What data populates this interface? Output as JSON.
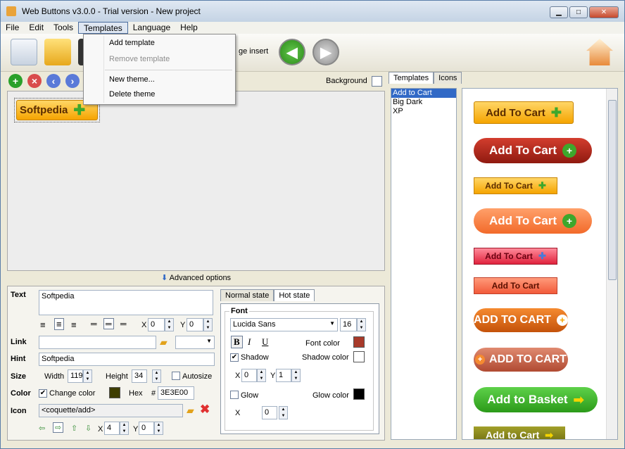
{
  "window": {
    "title": "Web Buttons v3.0.0 - Trial version - New project",
    "min": "▁",
    "max": "□",
    "close": "✕"
  },
  "menu": [
    "File",
    "Edit",
    "Tools",
    "Templates",
    "Language",
    "Help"
  ],
  "templates_menu": {
    "add": "Add template",
    "remove": "Remove template",
    "new_theme": "New theme...",
    "delete_theme": "Delete theme"
  },
  "toolbar": {
    "insert_label": "ge insert"
  },
  "canvas": {
    "button_label": "Softpedia",
    "background_label": "Background"
  },
  "advanced": "Advanced options",
  "props": {
    "text_label": "Text",
    "text_value": "Softpedia",
    "x_label": "X",
    "x_value": "0",
    "y_label": "Y",
    "y_value": "0",
    "link_label": "Link",
    "hint_label": "Hint",
    "hint_value": "Softpedia",
    "size_label": "Size",
    "width_label": "Width",
    "width_value": "119",
    "height_label": "Height",
    "height_value": "34",
    "autosize": "Autosize",
    "color_label": "Color",
    "change_color": "Change color",
    "hex_label": "Hex",
    "hash": "#",
    "hex_value": "3E3E00",
    "icon_label": "Icon",
    "icon_value": "<coquette/add>",
    "icon_x": "4",
    "icon_y": "0"
  },
  "state_tabs": [
    "Normal state",
    "Hot state"
  ],
  "font": {
    "group": "Font",
    "family": "Lucida Sans",
    "size": "16",
    "font_color": "Font color",
    "shadow": "Shadow",
    "shadow_color": "Shadow color",
    "sx": "0",
    "sy": "1",
    "glow": "Glow",
    "glow_color": "Glow color",
    "gx": "0"
  },
  "right_tabs": [
    "Templates",
    "Icons"
  ],
  "template_list": [
    "Add to Cart",
    "Big Dark",
    "XP"
  ],
  "preview_buttons": [
    "Add To Cart",
    "Add To Cart",
    "Add To Cart",
    "Add To Cart",
    "Add To Cart",
    "Add To Cart",
    "ADD TO CART",
    "ADD TO CART",
    "Add to Basket",
    "Add to Cart"
  ],
  "colors": {
    "font_color": "#a83a2a",
    "shadow_color": "#ffffff",
    "glow_color": "#000000",
    "change_color": "#3e3e00",
    "accent": "#3169c6"
  }
}
